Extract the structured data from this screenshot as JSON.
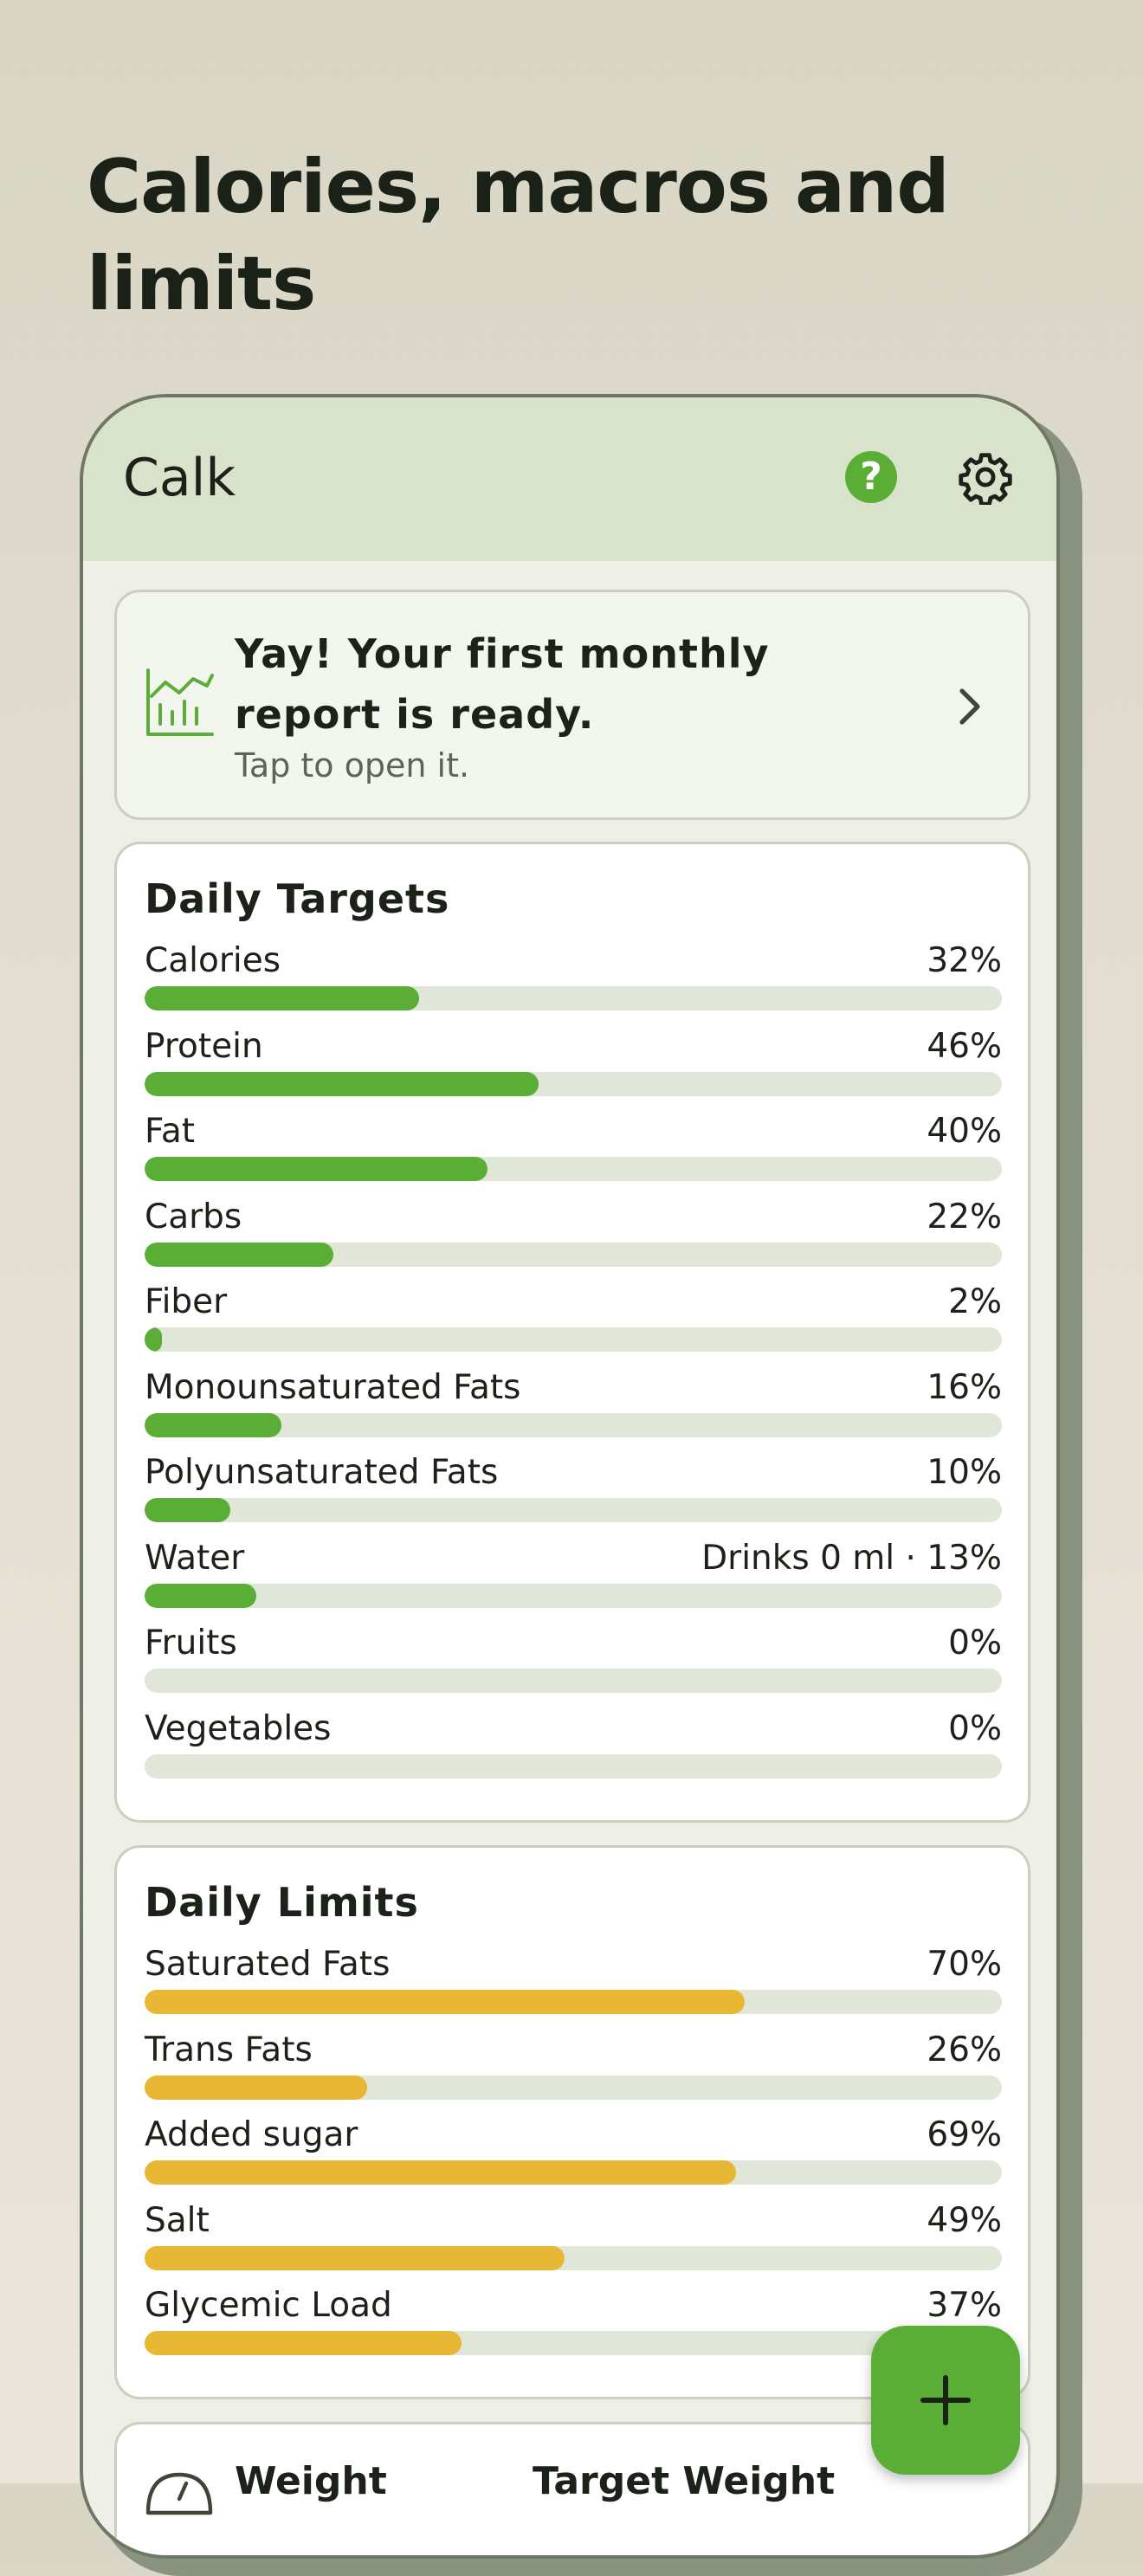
{
  "headline": "Calories, macros and limits",
  "app": {
    "title": "Calk",
    "help_icon": "question-circle-icon",
    "settings_icon": "gear-icon",
    "help_glyph": "?"
  },
  "report": {
    "title": "Yay! Your first monthly report is ready.",
    "subtitle": "Tap to open it.",
    "icon": "chart-icon"
  },
  "targets": {
    "title": "Daily Targets",
    "rows": [
      {
        "label": "Calories",
        "value": "32%",
        "level": 0.32
      },
      {
        "label": "Protein",
        "value": "46%",
        "level": 0.46
      },
      {
        "label": "Fat",
        "value": "40%",
        "level": 0.4
      },
      {
        "label": "Carbs",
        "value": "22%",
        "level": 0.22
      },
      {
        "label": "Fiber",
        "value": "2%",
        "level": 0.02
      },
      {
        "label": "Monounsaturated Fats",
        "value": "16%",
        "level": 0.16
      },
      {
        "label": "Polyunsaturated Fats",
        "value": "10%",
        "level": 0.1
      },
      {
        "label": "Water",
        "value": "Drinks 0 ml · 13%",
        "level": 0.13
      },
      {
        "label": "Fruits",
        "value": "0%",
        "level": 0
      },
      {
        "label": "Vegetables",
        "value": "0%",
        "level": 0
      }
    ]
  },
  "limits": {
    "title": "Daily Limits",
    "rows": [
      {
        "label": "Saturated Fats",
        "value": "70%",
        "level": 0.7
      },
      {
        "label": "Trans Fats",
        "value": "26%",
        "level": 0.26
      },
      {
        "label": "Added sugar",
        "value": "69%",
        "level": 0.69
      },
      {
        "label": "Salt",
        "value": "49%",
        "level": 0.49
      },
      {
        "label": "Glycemic Load",
        "value": "37%",
        "level": 0.37
      }
    ]
  },
  "weight": {
    "label": "Weight",
    "target_label": "Target Weight",
    "icon": "scale-icon"
  },
  "fab": {
    "icon": "plus-icon"
  },
  "colors": {
    "accent": "#5aae36",
    "limit": "#e8b734",
    "appbar": "#d9e3cc",
    "track": "#e0e6d8"
  }
}
